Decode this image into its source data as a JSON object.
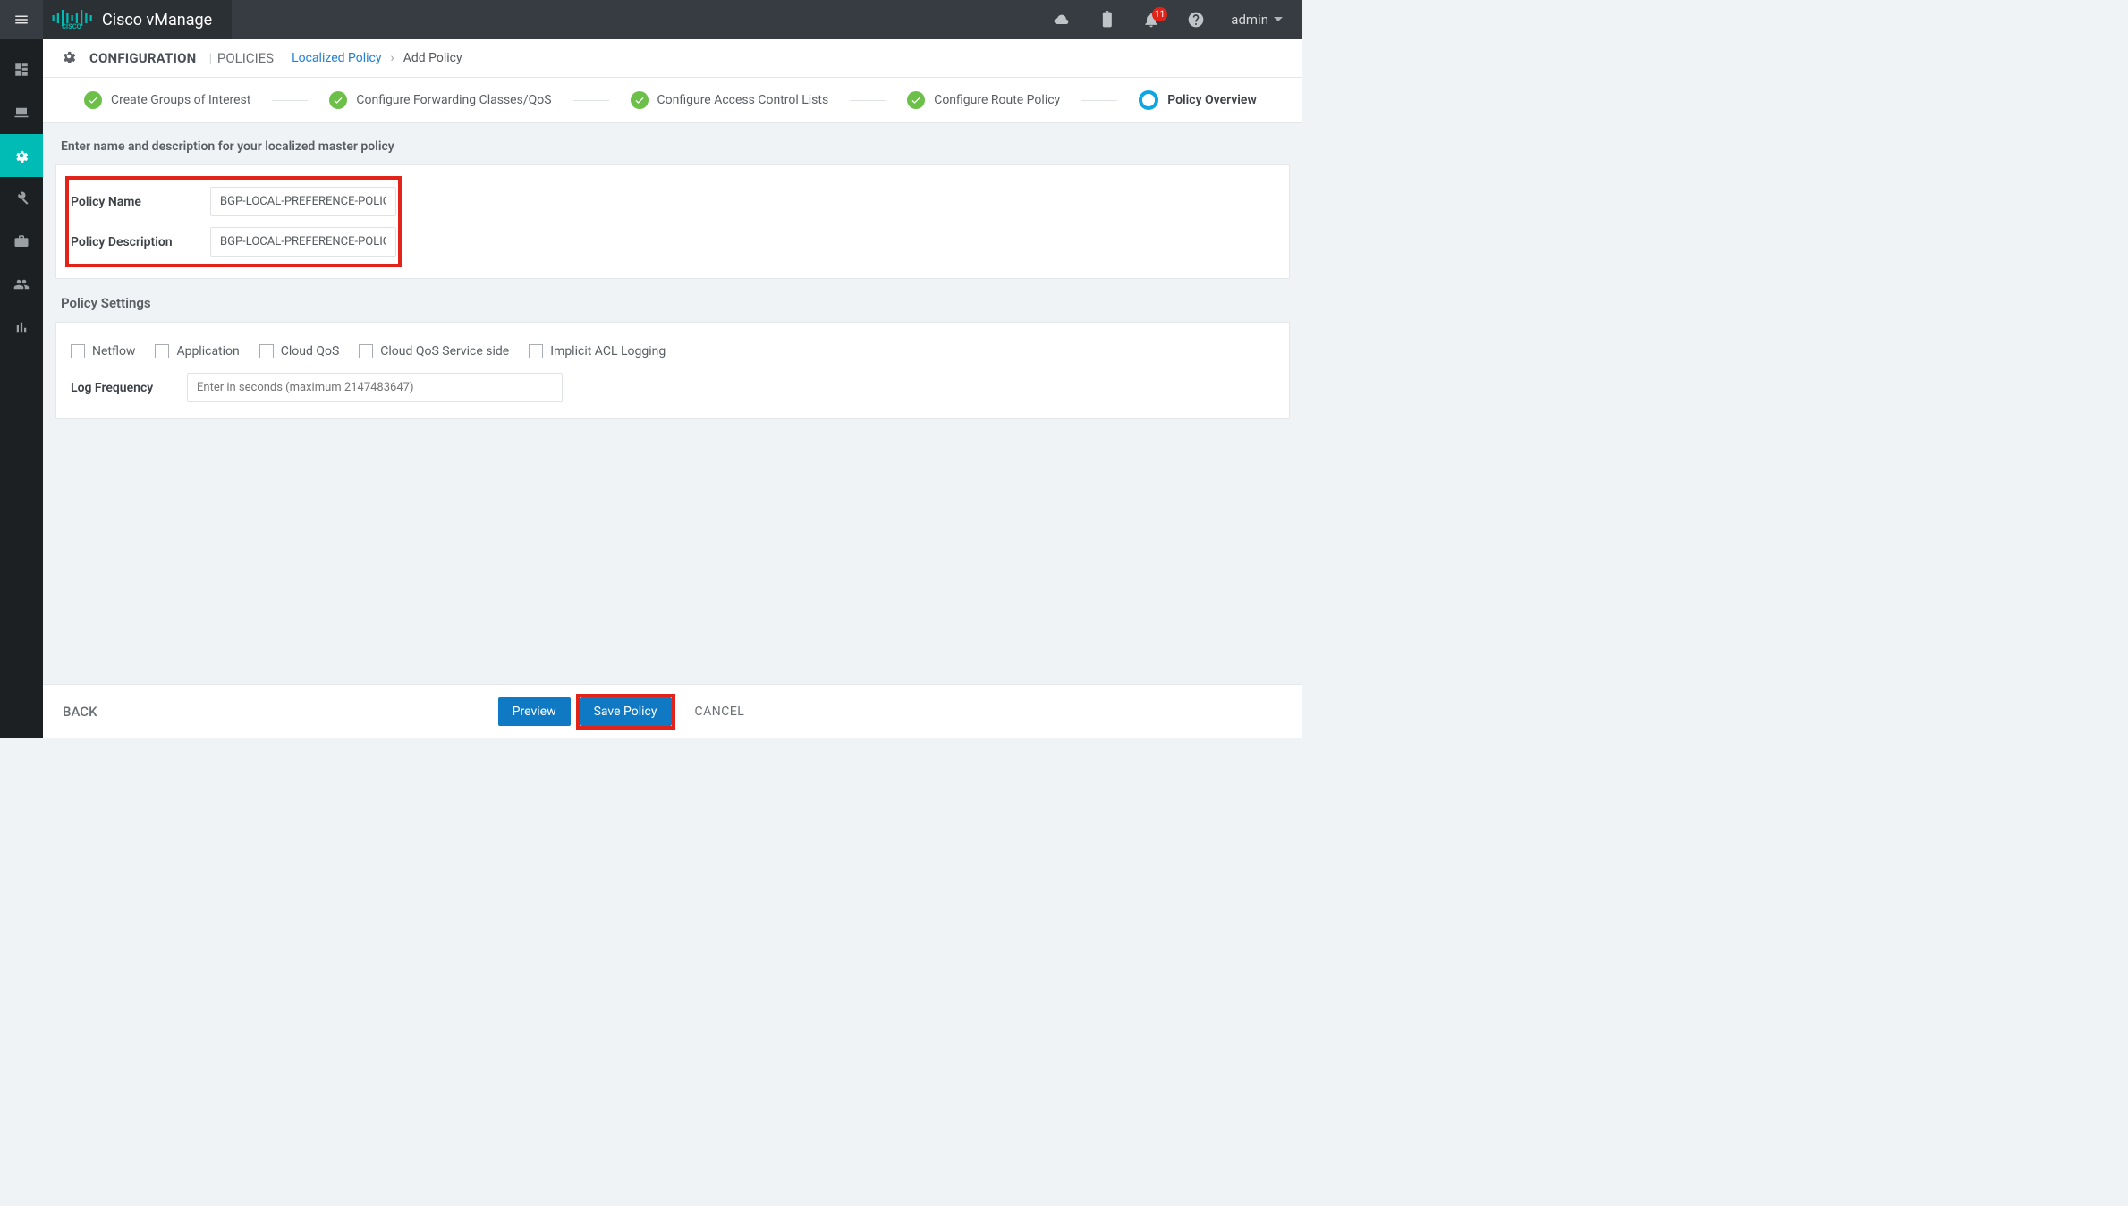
{
  "brand": {
    "title": "Cisco vManage"
  },
  "top": {
    "notif_count": "11",
    "user": "admin"
  },
  "breadcrumb": {
    "section": "CONFIGURATION",
    "subsection": "POLICIES",
    "link": "Localized Policy",
    "current": "Add Policy"
  },
  "steps": {
    "s1": "Create Groups of Interest",
    "s2": "Configure Forwarding Classes/QoS",
    "s3": "Configure Access Control Lists",
    "s4": "Configure Route Policy",
    "s5": "Policy Overview"
  },
  "intro": "Enter name and description for your localized master policy",
  "form": {
    "name_label": "Policy Name",
    "name_value": "BGP-LOCAL-PREFERENCE-POLICY",
    "desc_label": "Policy Description",
    "desc_value": "BGP-LOCAL-PREFERENCE-POLICY"
  },
  "settings_heading": "Policy Settings",
  "checkboxes": {
    "netflow": "Netflow",
    "application": "Application",
    "cloud_qos": "Cloud QoS",
    "cloud_qos_service": "Cloud QoS Service side",
    "implicit_acl": "Implicit ACL Logging"
  },
  "log": {
    "label": "Log Frequency",
    "placeholder": "Enter in seconds (maximum 2147483647)"
  },
  "footer": {
    "back": "BACK",
    "preview": "Preview",
    "save": "Save Policy",
    "cancel": "CANCEL"
  }
}
